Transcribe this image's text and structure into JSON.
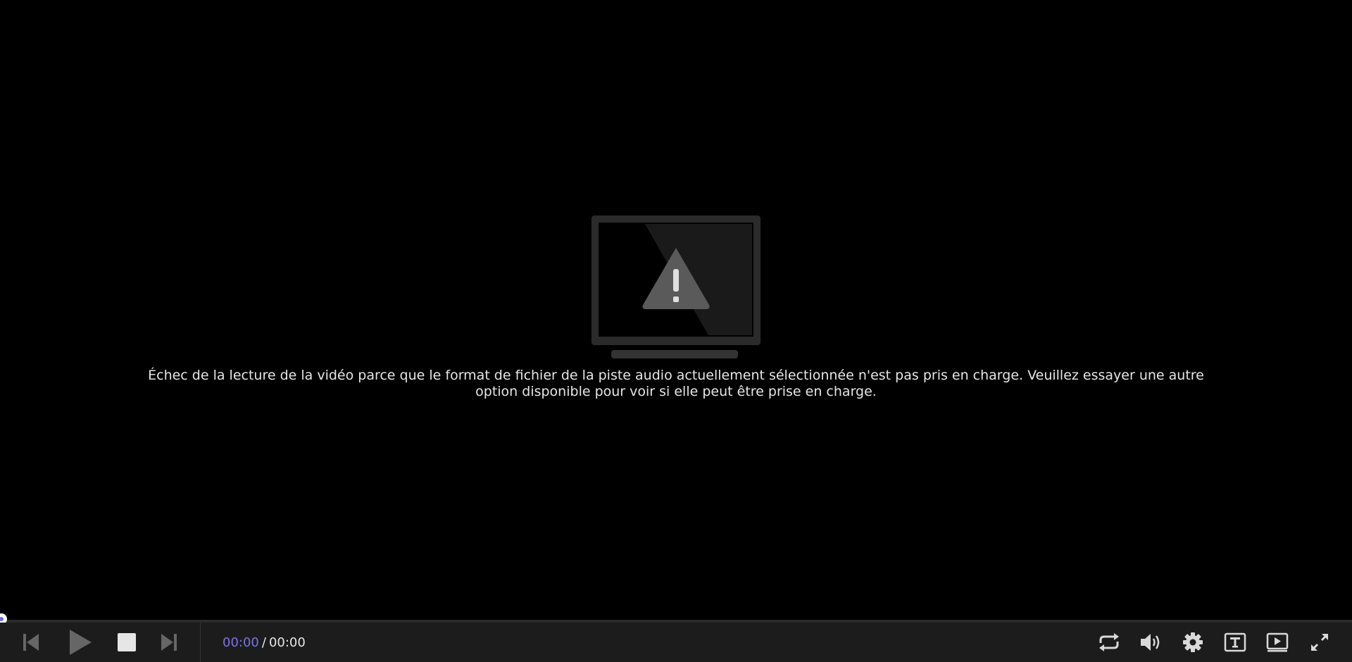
{
  "player": {
    "error_message_line1": "Échec de la lecture de la vidéo parce que le format de fichier de la piste audio actuellement sélectionnée n'est pas pris en charge. Veuillez essayer une autre",
    "error_message_line2": "option disponible pour voir si elle peut être prise en charge.",
    "time": {
      "current": "00:00",
      "separator": "/",
      "total": "00:00"
    },
    "progress": 0,
    "colors": {
      "accent": "#7b74e8",
      "background": "#000000",
      "control_bar": "#1c1c1c",
      "icon": "#d9d9d9",
      "icon_dim": "#666666"
    },
    "controls_left": [
      "previous-icon",
      "play-icon",
      "stop-icon",
      "next-icon"
    ],
    "controls_right": [
      "loop-icon",
      "volume-icon",
      "settings-icon",
      "subtitles-icon",
      "playlist-icon",
      "fullscreen-icon"
    ]
  }
}
